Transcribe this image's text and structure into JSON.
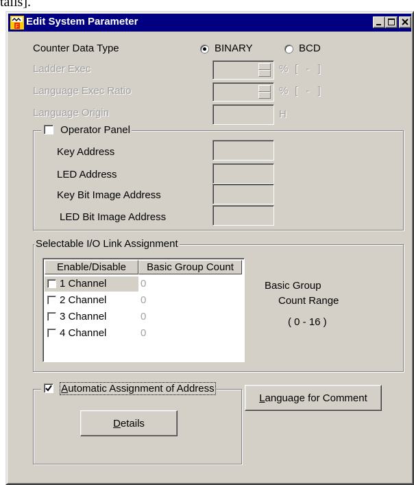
{
  "page_top_text": "tails].",
  "window": {
    "title": "Edit System Parameter",
    "controls": [
      "minimize",
      "maximize",
      "close"
    ]
  },
  "counter_data_type": {
    "label": "Counter Data Type",
    "options": [
      "BINARY",
      "BCD"
    ],
    "selected": "BINARY"
  },
  "ladder_exec": {
    "label": "Ladder Exec",
    "unit": "%",
    "range": "[ - ]",
    "value": ""
  },
  "language_exec_ratio": {
    "label": "Language Exec Ratio",
    "unit": "%",
    "range": "[ - ]",
    "value": ""
  },
  "language_origin": {
    "label": "Language Origin",
    "unit": "H",
    "value": ""
  },
  "operator_panel": {
    "label": "Operator Panel",
    "checked": false,
    "fields": [
      {
        "label": "Key Address",
        "value": ""
      },
      {
        "label": "LED Address",
        "value": ""
      },
      {
        "label": "Key Bit Image Address",
        "value": ""
      },
      {
        "label": "LED Bit Image Address",
        "value": ""
      }
    ]
  },
  "io_link": {
    "group_label": "Selectable I/O Link Assignment",
    "columns": [
      "Enable/Disable",
      "Basic Group Count"
    ],
    "rows": [
      {
        "name": "1 Channel",
        "count": "0",
        "checked": false,
        "highlighted": true
      },
      {
        "name": "2 Channel",
        "count": "0",
        "checked": false,
        "highlighted": false
      },
      {
        "name": "3 Channel",
        "count": "0",
        "checked": false,
        "highlighted": false
      },
      {
        "name": "4 Channel",
        "count": "0",
        "checked": false,
        "highlighted": false
      }
    ],
    "range_line1": "Basic Group",
    "range_line2": "Count Range",
    "range_value": "( 0 - 16 )"
  },
  "auto_assign": {
    "label": "Automatic Assignment of Address",
    "checked": true,
    "details_button": "Details"
  },
  "language_comment_button": "Language for Comment",
  "colors": {
    "title_bar": "#000080",
    "face": "#d4d0c8",
    "disabled_text": "#a0a0a0",
    "highlight": "#d4d0c8"
  }
}
